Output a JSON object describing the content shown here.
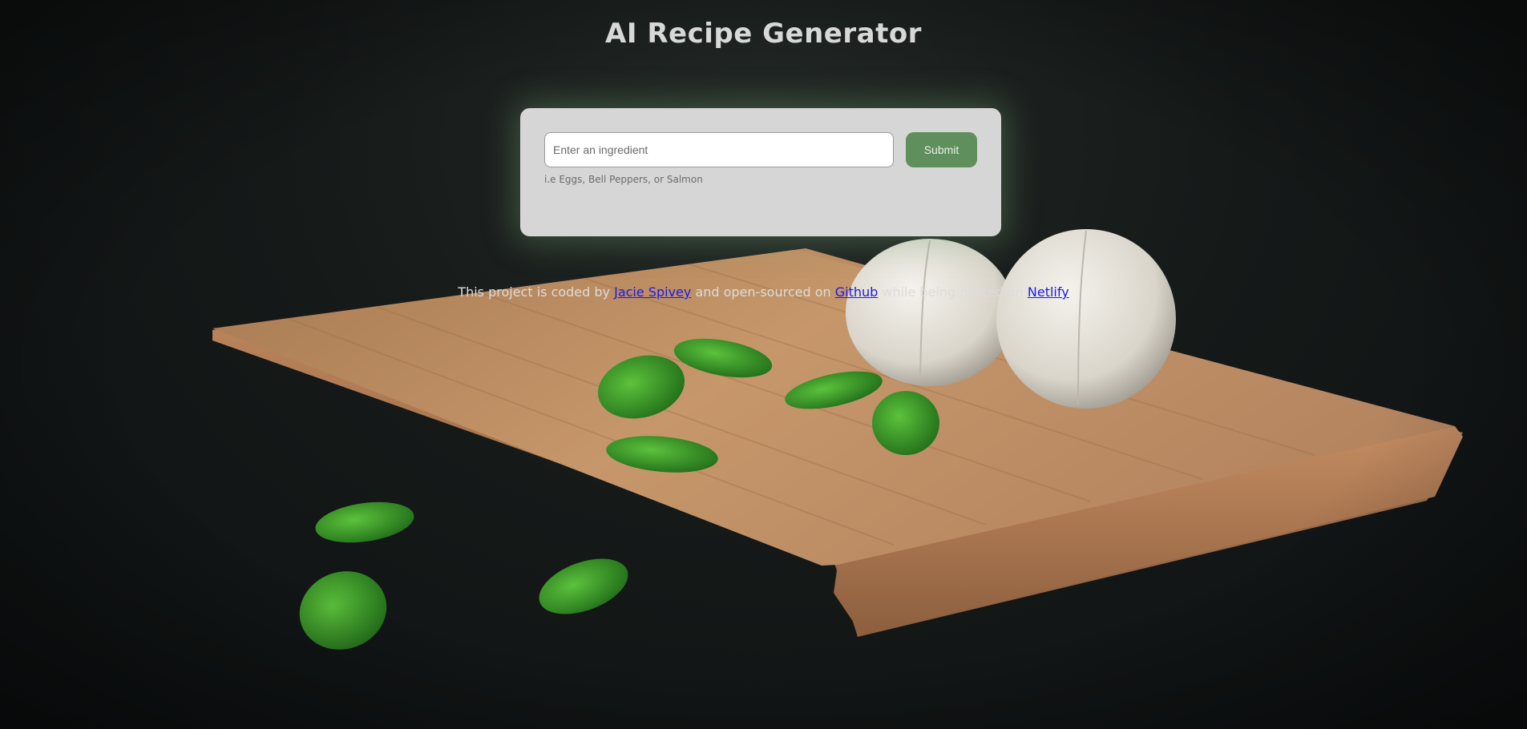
{
  "page": {
    "title": "AI Recipe Generator"
  },
  "form": {
    "input_placeholder": "Enter an ingredient",
    "input_value": "",
    "submit_label": "Submit",
    "helper_text": "i.e Eggs, Bell Peppers, or Salmon"
  },
  "footer": {
    "text_1": "This project is coded by ",
    "author_link": "Jacie Spivey",
    "text_2": " and open-sourced on ",
    "repo_link": "Github",
    "text_3": " while being hosted on ",
    "host_link": "Netlify"
  },
  "colors": {
    "background": "#121516",
    "card": "#d6d6d6",
    "submit_button": "#5f8f5c",
    "link": "#1a1aee",
    "title_text": "#d8d8d8"
  }
}
